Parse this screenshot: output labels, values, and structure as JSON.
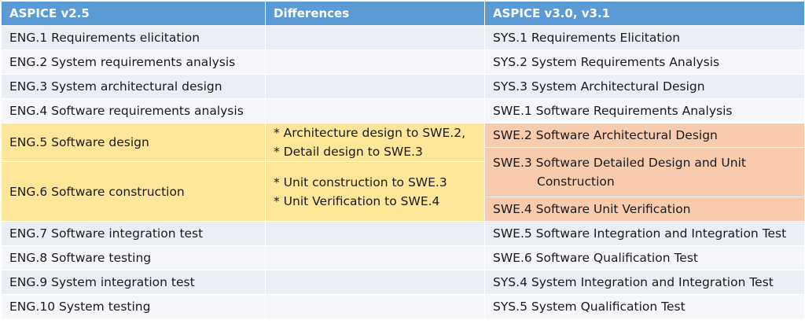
{
  "headers": [
    "ASPICE v2.5",
    "Differences",
    "ASPICE v3.0, v3.1"
  ],
  "rows_top": [
    {
      "old": "ENG.1 Requirements elicitation",
      "new": "SYS.1 Requirements Elicitation"
    },
    {
      "old": "ENG.2 System requirements analysis",
      "new": "SYS.2 System Requirements Analysis"
    },
    {
      "old": "ENG.3 System architectural design",
      "new": "SYS.3 System Architectural Design"
    },
    {
      "old": "ENG.4 Software requirements analysis",
      "new": "SWE.1 Software Requirements Analysis"
    }
  ],
  "highlight": {
    "eng5": "ENG.5 Software design",
    "eng6": "ENG.6 Software construction",
    "diff5": [
      "* Architecture design to SWE.2,",
      "* Detail design to SWE.3"
    ],
    "diff6": [
      "* Unit construction to SWE.3",
      "* Unit Verification to SWE.4"
    ],
    "swe2": "SWE.2 Software Architectural Design",
    "swe3_line1": "SWE.3 Software Detailed Design and Unit",
    "swe3_line2": "Construction",
    "swe4": "SWE.4 Software Unit Verification"
  },
  "rows_bottom": [
    {
      "old": "ENG.7 Software integration test",
      "new": "SWE.5 Software Integration and Integration Test"
    },
    {
      "old": "ENG.8 Software testing",
      "new": "SWE.6 Software Qualification Test"
    },
    {
      "old": "ENG.9 System integration test",
      "new": "SYS.4 System Integration and Integration Test"
    },
    {
      "old": "ENG.10 System testing",
      "new": "SYS.5 System Qualification Test"
    }
  ],
  "colors": {
    "header": "#5b9bd5",
    "row_odd": "#eaeff5",
    "row_even": "#f5f7fa",
    "yellow": "#ffe699",
    "orange": "#f8cbad"
  }
}
